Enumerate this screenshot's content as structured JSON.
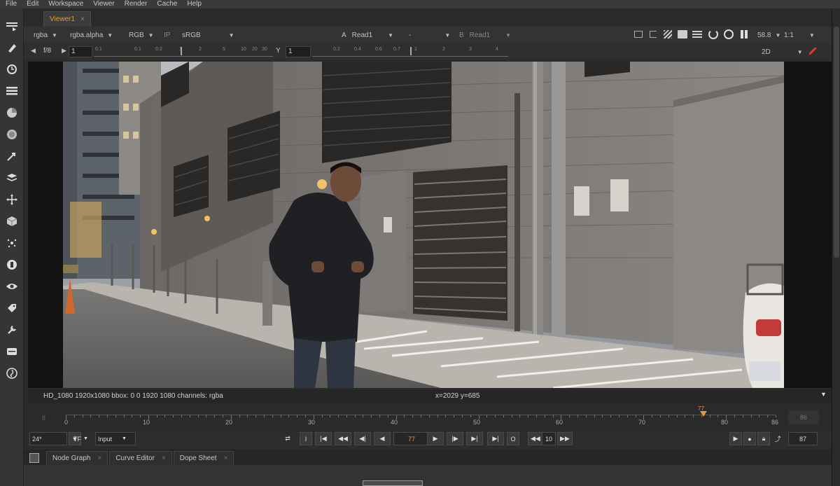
{
  "menu": [
    "File",
    "Edit",
    "Workspace",
    "Viewer",
    "Render",
    "Cache",
    "Help"
  ],
  "viewer_tab": {
    "label": "Viewer1",
    "close": "×"
  },
  "viewer_bar": {
    "layer": "rgba",
    "alpha": "rgba.alpha",
    "display": "RGB",
    "ip": "IP",
    "colorspace": "sRGB",
    "a_label": "A",
    "a_input": "Read1",
    "wipe": "-",
    "b_label": "B",
    "b_input": "Read1",
    "zoom": "58.8",
    "ratio": "1:1"
  },
  "gain_bar": {
    "fstop": "f/8",
    "gain_value": "1",
    "gain_ticks": [
      "0.1",
      "0.2",
      "1",
      "2",
      "5",
      "10",
      "15",
      "20",
      "30"
    ],
    "gamma_label": "Y",
    "gamma_value": "1",
    "gamma_ticks": [
      "0.2",
      "0.4",
      "0.6",
      "0.7",
      "1",
      "2",
      "3",
      "4"
    ],
    "view_mode": "2D"
  },
  "info_bar": {
    "format": "HD_1080 1920x1080  bbox: 0 0 1920 1080 channels: rgba",
    "coords": "x=2029 y=685"
  },
  "timeline": {
    "current_frame": 77,
    "start": 0,
    "end": 86,
    "ticks": [
      "0",
      "10",
      "20",
      "30",
      "40",
      "50",
      "60",
      "70",
      "80",
      "86"
    ],
    "end_label": "86"
  },
  "controls": {
    "fps": "24*",
    "tf": "TF",
    "input": "Input",
    "frame": "77",
    "skip": "10",
    "last_frame": "87",
    "in_mark": "I",
    "out_mark": "O"
  },
  "bottom_tabs": [
    {
      "label": "Node Graph",
      "close": "×"
    },
    {
      "label": "Curve Editor",
      "close": "×"
    },
    {
      "label": "Dope Sheet",
      "close": "×"
    }
  ],
  "colors": {
    "accent": "#e39a3b",
    "bg": "#2b2b2b"
  },
  "tool_icons": [
    "viewer-icon",
    "paint-icon",
    "time-icon",
    "channel-icon",
    "color-icon",
    "filter-icon",
    "keyer-icon",
    "merge-icon",
    "transform-icon",
    "3d-icon",
    "particles-icon",
    "deep-icon",
    "views-icon",
    "metadata-icon",
    "toolsets-icon",
    "other-icon",
    "furnace-icon"
  ]
}
